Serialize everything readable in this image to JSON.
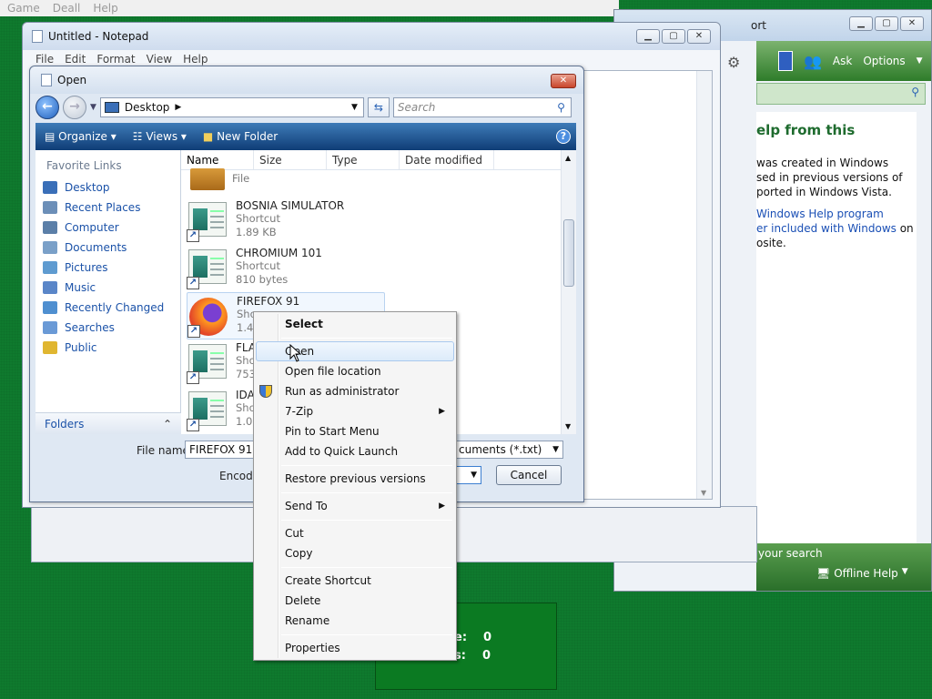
{
  "game": {
    "menu": [
      "Game",
      "Deall",
      "Help"
    ],
    "score_rows": [
      {
        "label": "e:",
        "value": "0"
      },
      {
        "label": "s:",
        "value": "0"
      }
    ]
  },
  "help_window": {
    "title_fragment": "ort",
    "toolbar": {
      "ask": "Ask",
      "options": "Options"
    },
    "heading": "elp from this",
    "paragraph": [
      "was created in Windows",
      "sed in previous versions of",
      "ported in Windows Vista."
    ],
    "link_lines": [
      "Windows Help program",
      "er included with Windows"
    ],
    "link_suffix": "on",
    "last_line": "osite.",
    "footer_search": "your search",
    "offline_help": "Offline Help"
  },
  "notepad": {
    "title": "Untitled - Notepad",
    "menu": [
      "File",
      "Edit",
      "Format",
      "View",
      "Help"
    ]
  },
  "open_dialog": {
    "title": "Open",
    "address": "Desktop",
    "search_placeholder": "Search",
    "commands": {
      "organize": "Organize",
      "views": "Views",
      "new_folder": "New Folder"
    },
    "favorite_links_header": "Favorite Links",
    "favorite_links": [
      {
        "label": "Desktop",
        "icon": "desktop-icon",
        "color": "#3a6fb8"
      },
      {
        "label": "Recent Places",
        "icon": "recent-places-icon",
        "color": "#6c8fb8"
      },
      {
        "label": "Computer",
        "icon": "computer-icon",
        "color": "#5b7fa8"
      },
      {
        "label": "Documents",
        "icon": "documents-icon",
        "color": "#7aa0c8"
      },
      {
        "label": "Pictures",
        "icon": "pictures-icon",
        "color": "#5f9bd0"
      },
      {
        "label": "Music",
        "icon": "music-icon",
        "color": "#5a86c8"
      },
      {
        "label": "Recently Changed",
        "icon": "recently-changed-icon",
        "color": "#4f8fd0"
      },
      {
        "label": "Searches",
        "icon": "searches-icon",
        "color": "#6a9ad6"
      },
      {
        "label": "Public",
        "icon": "public-icon",
        "color": "#e0b630"
      }
    ],
    "folders_label": "Folders",
    "columns": [
      "Name",
      "Size",
      "Type",
      "Date modified"
    ],
    "files": [
      {
        "name": "",
        "type": "File",
        "size": ""
      },
      {
        "name": "BOSNIA SIMULATOR",
        "type": "Shortcut",
        "size": "1.89 KB"
      },
      {
        "name": "CHROMIUM 101",
        "type": "Shortcut",
        "size": "810 bytes"
      },
      {
        "name": "FIREFOX 91",
        "type": "Sho",
        "size": "1.49"
      },
      {
        "name": "FLA",
        "type": "Sho",
        "size": "753"
      },
      {
        "name": "IDA",
        "type": "Sho",
        "size": "1.03"
      }
    ],
    "file_name_label": "File name:",
    "file_name_value": "FIREFOX 91",
    "filetype_value": "cuments (*.txt)",
    "encoding_label": "Encodin",
    "cancel_label": "Cancel"
  },
  "context_menu": {
    "items": [
      {
        "label": "Select",
        "bold": true
      },
      {
        "label": "Open",
        "hover": true
      },
      {
        "label": "Open file location"
      },
      {
        "label": "Run as administrator",
        "icon": "shield-icon"
      },
      {
        "label": "7-Zip",
        "submenu": true
      },
      {
        "label": "Pin to Start Menu"
      },
      {
        "label": "Add to Quick Launch"
      },
      {
        "label": "Restore previous versions"
      },
      {
        "label": "Send To",
        "submenu": true
      },
      {
        "label": "Cut"
      },
      {
        "label": "Copy"
      },
      {
        "label": "Create Shortcut"
      },
      {
        "label": "Delete"
      },
      {
        "label": "Rename"
      },
      {
        "label": "Properties"
      }
    ]
  }
}
